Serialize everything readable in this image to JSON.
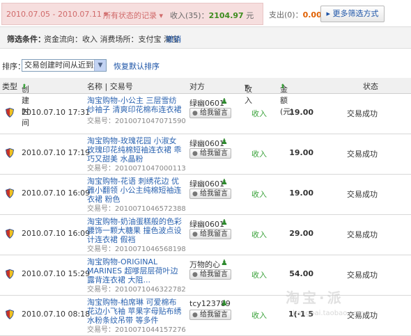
{
  "topbar": {
    "date_range": "2010.07.05 - 2010.07.11 ▾",
    "records": "所有状态的记录 ▾",
    "income_label": "收入(35)：",
    "income_value": "2104.97",
    "income_unit": " 元",
    "expense_label": "支出(0)：",
    "expense_value": "0.00",
    "expense_unit": " 元",
    "more_filter": "▸ 更多筛选方式"
  },
  "filter": {
    "label": "筛选条件：",
    "conditions": "资金流向：收入  消费场所：支付宝  淘宝",
    "cancel": "撤销"
  },
  "sort": {
    "label": "排序：",
    "selected": "交易创建时间从近到远",
    "reset": "恢复默认排序"
  },
  "header": {
    "type": "类型",
    "created": "创建时间",
    "name": "名称 | 交易号",
    "party": "对方",
    "inout": "收入",
    "amount": "金额(元)",
    "status": "状态"
  },
  "rows": [
    {
      "time": "2010.07.10 17:31",
      "title": "淘宝购物-小公主 三层雪纺纱袖子 清爽印花棉布连衣裙",
      "txno": "交易号：2010071047071590",
      "party": "绿幽0601",
      "msg": "给我留言",
      "inout": "收入",
      "amount": "19.00",
      "status": "交易成功"
    },
    {
      "time": "2010.07.10 17:19",
      "title": "淘宝购物-玫瑰花园 小淑女玫瑰印花纯棉短袖连衣裙 乖巧又甜美 水晶粉",
      "txno": "交易号：2010071047000113",
      "party": "绿幽0601",
      "msg": "给我留言",
      "inout": "收入",
      "amount": "19.00",
      "status": "交易成功"
    },
    {
      "time": "2010.07.10 16:09",
      "title": "淘宝购物-花语 刺绣花边 优雅小翻领 小公主纯棉短袖连衣裙 粉色",
      "txno": "交易号：2010071046572388",
      "party": "绿幽0601",
      "msg": "给我留言",
      "inout": "收入",
      "amount": "19.00",
      "status": "交易成功"
    },
    {
      "time": "2010.07.10 16:09",
      "title": "淘宝购物-奶油蛋糕般的色彩 腰饰一颗大糖果 撞色波点设计连衣裙 假裆",
      "txno": "交易号：2010071046568198",
      "party": "绿幽0601",
      "msg": "给我留言",
      "inout": "收入",
      "amount": "29.00",
      "status": "交易成功"
    },
    {
      "time": "2010.07.10 15:29",
      "title": "淘宝购物-ORIGINAL MARINES 超嗲层层荷叶边露背连衣裙 大阻...",
      "txno": "交易号：2010071046322782",
      "party": "万物的心",
      "msg": "给我留言",
      "inout": "收入",
      "amount": "54.00",
      "status": "交易成功"
    },
    {
      "time": "2010.07.10 08:18",
      "title": "淘宝购物-柏席琳 可爱棉布花边小飞袖 苹果字母贴布绣 水粉条纹吊带 等多件",
      "txno": "交易号：2010071044157276",
      "party": "tcy123789",
      "msg": "给我留言",
      "inout": "收入",
      "amount": "1(·1 5",
      "status": "交易成功"
    }
  ],
  "watermark": {
    "logo": "淘宝·派",
    "url": "bangpai.taobao.com"
  },
  "colors": {
    "link": "#2b63b0",
    "income": "#3aa23a",
    "range_bg": "#f6dede",
    "amount_highlight": "#3d8c1e",
    "expense": "#e06000"
  }
}
